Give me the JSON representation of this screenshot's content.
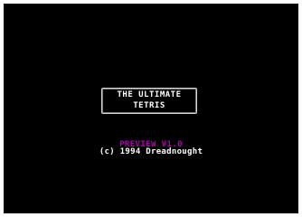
{
  "title_screen": {
    "title_line1": "THE ULTIMATE",
    "title_line2": "TETRIS",
    "preview": "PREVIEW V1.0",
    "copyright": "(c) 1994 Dreadnought"
  },
  "colors": {
    "background": "#000000",
    "frame": "#ffffff",
    "text": "#ffffff",
    "preview_accent": "#b000b0"
  }
}
